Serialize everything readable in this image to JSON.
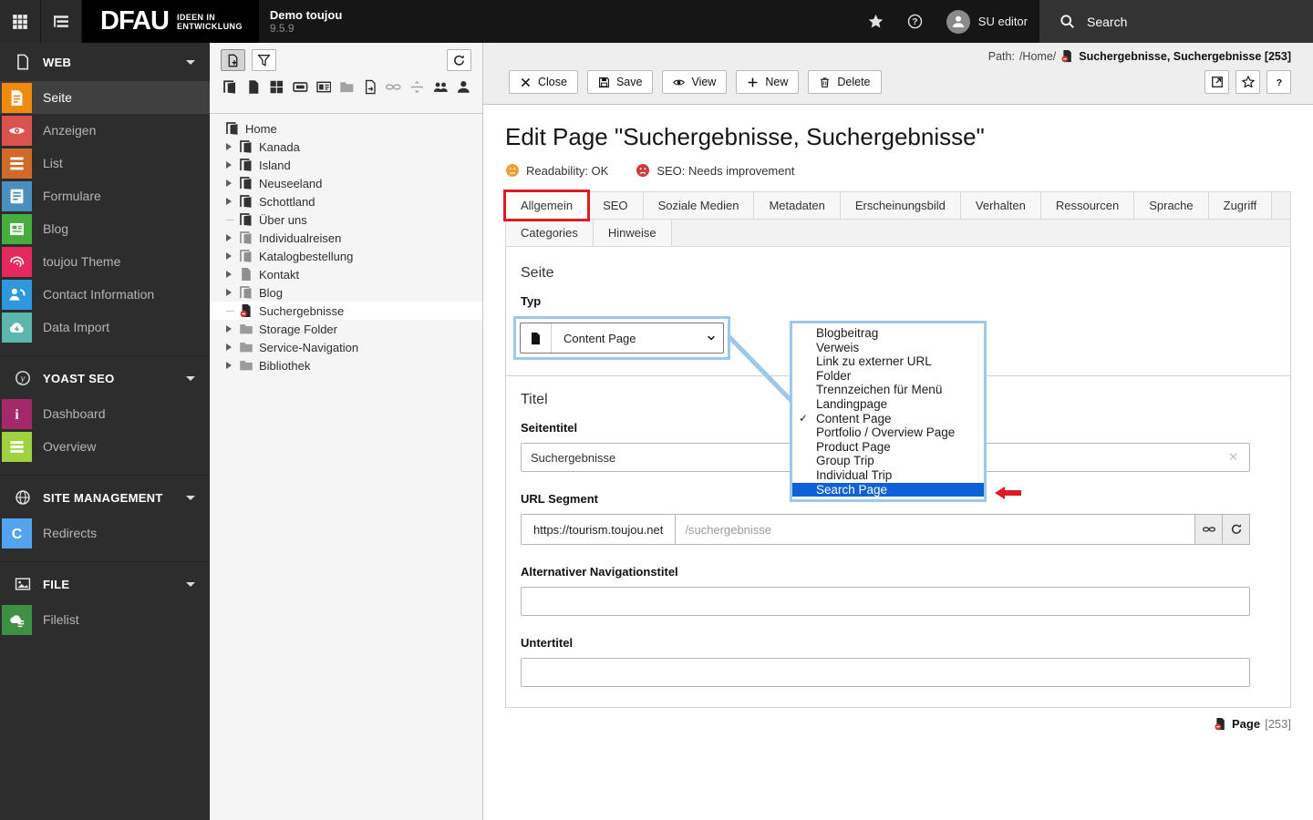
{
  "topbar": {
    "brand": {
      "logo": "DFAU",
      "tagline_line1": "IDEEN IN",
      "tagline_line2": "ENTWICKLUNG",
      "site_name": "Demo toujou",
      "version": "9.5.9"
    },
    "user": "SU editor",
    "search_label": "Search"
  },
  "module_menu": {
    "sections": [
      {
        "label": "WEB",
        "icon": "webdoc",
        "items": [
          {
            "label": "Seite",
            "icon": "pagelines",
            "color": "#ef8a0e",
            "active": true
          },
          {
            "label": "Anzeigen",
            "icon": "eyetile",
            "color": "#d9534f",
            "active": false
          },
          {
            "label": "List",
            "icon": "listlines",
            "color": "#d06a28",
            "active": false
          },
          {
            "label": "Formulare",
            "icon": "formtile",
            "color": "#4a8fbe",
            "active": false
          },
          {
            "label": "Blog",
            "icon": "newstile",
            "color": "#47ad3f",
            "active": false
          },
          {
            "label": "toujou Theme",
            "icon": "fingerprint",
            "color": "#e42a5c",
            "active": false
          },
          {
            "label": "Contact Information",
            "icon": "contacttile",
            "color": "#2e97de",
            "active": false
          },
          {
            "label": "Data Import",
            "icon": "clouddown",
            "color": "#5bb7ac",
            "active": false
          }
        ]
      },
      {
        "label": "YOAST SEO",
        "icon": "yoast",
        "items": [
          {
            "label": "Dashboard",
            "icon": "infotile",
            "color": "#a4286a",
            "active": false
          },
          {
            "label": "Overview",
            "icon": "barstile",
            "color": "#9ed33f",
            "active": false
          }
        ]
      },
      {
        "label": "SITE MANAGEMENT",
        "icon": "globe",
        "items": [
          {
            "label": "Redirects",
            "icon": "redirectc",
            "color": "#53a3ef",
            "active": false
          }
        ]
      },
      {
        "label": "FILE",
        "icon": "imagepic",
        "items": [
          {
            "label": "Filelist",
            "icon": "filelist",
            "color": "#3f8f44",
            "active": false
          }
        ]
      }
    ]
  },
  "pagetree": {
    "items": [
      {
        "label": "Home",
        "icon": "site",
        "depth": 0,
        "expander": false,
        "selected": false
      },
      {
        "label": "Kanada",
        "icon": "site",
        "depth": 1,
        "expander": true,
        "selected": false
      },
      {
        "label": "Island",
        "icon": "site",
        "depth": 1,
        "expander": true,
        "selected": false
      },
      {
        "label": "Neuseeland",
        "icon": "site",
        "depth": 1,
        "expander": true,
        "selected": false
      },
      {
        "label": "Schottland",
        "icon": "site",
        "depth": 1,
        "expander": true,
        "selected": false
      },
      {
        "label": "Über uns",
        "icon": "site",
        "depth": 1,
        "expander": false,
        "selected": false
      },
      {
        "label": "Individualreisen",
        "icon": "site-muted",
        "depth": 1,
        "expander": true,
        "selected": false
      },
      {
        "label": "Katalogbestellung",
        "icon": "site-muted",
        "depth": 1,
        "expander": true,
        "selected": false
      },
      {
        "label": "Kontakt",
        "icon": "page-muted",
        "depth": 1,
        "expander": true,
        "selected": false
      },
      {
        "label": "Blog",
        "icon": "site-muted",
        "depth": 1,
        "expander": true,
        "selected": false
      },
      {
        "label": "Suchergebnisse",
        "icon": "page-hidden",
        "depth": 1,
        "expander": false,
        "selected": true
      },
      {
        "label": "Storage Folder",
        "icon": "folder",
        "depth": 1,
        "expander": true,
        "selected": false
      },
      {
        "label": "Service-Navigation",
        "icon": "folder",
        "depth": 1,
        "expander": true,
        "selected": false
      },
      {
        "label": "Bibliothek",
        "icon": "folder",
        "depth": 1,
        "expander": true,
        "selected": false
      }
    ]
  },
  "doc_header": {
    "path_label": "Path:",
    "path_value": "/Home/",
    "record_title": "Suchergebnisse, Suchergebnisse",
    "record_uid": "[253]",
    "buttons": [
      {
        "label": "Close",
        "icon": "closex"
      },
      {
        "label": "Save",
        "icon": "save"
      },
      {
        "label": "View",
        "icon": "vieweye"
      },
      {
        "label": "New",
        "icon": "plus"
      },
      {
        "label": "Delete",
        "icon": "trash"
      }
    ]
  },
  "content": {
    "title": "Edit Page \"Suchergebnisse, Suchergebnisse\"",
    "status": [
      {
        "label": "Readability: OK",
        "type": "ok"
      },
      {
        "label": "SEO: Needs improvement",
        "type": "bad"
      }
    ],
    "tabs_row1": [
      "Allgemein",
      "SEO",
      "Soziale Medien",
      "Metadaten",
      "Erscheinungsbild",
      "Verhalten",
      "Ressourcen",
      "Sprache",
      "Zugriff"
    ],
    "tabs_row2": [
      "Categories",
      "Hinweise"
    ],
    "active_tab": "Allgemein",
    "form": {
      "section1_title": "Seite",
      "type_label": "Typ",
      "type_value": "Content Page",
      "section2_title": "Titel",
      "pagetitle_label": "Seitentitel",
      "pagetitle_value": "Suchergebnisse",
      "slug_label": "URL Segment",
      "slug_prefix": "https://tourism.toujou.net",
      "slug_value": "/suchergebnisse",
      "navtitle_label": "Alternativer Navigationstitel",
      "subtitle_label": "Untertitel"
    },
    "footer": {
      "record_type": "Page",
      "record_uid": "[253]"
    }
  },
  "dropdown": {
    "options": [
      "Blogbeitrag",
      "Verweis",
      "Link zu externer URL",
      "Folder",
      "Trennzeichen für Menü",
      "Landingpage",
      "Content Page",
      "Portfolio / Overview Page",
      "Product Page",
      "Group Trip",
      "Individual Trip",
      "Search Page"
    ],
    "checked": "Content Page",
    "highlighted": "Search Page"
  },
  "colors": {
    "annotation_red": "#e01b24",
    "annotation_blue": "#9cc7ee",
    "selection_blue": "#0f62d6",
    "status_ok": "#ef9d33",
    "status_bad": "#cf3b3b",
    "hidden_badge_red": "#ca3832"
  }
}
